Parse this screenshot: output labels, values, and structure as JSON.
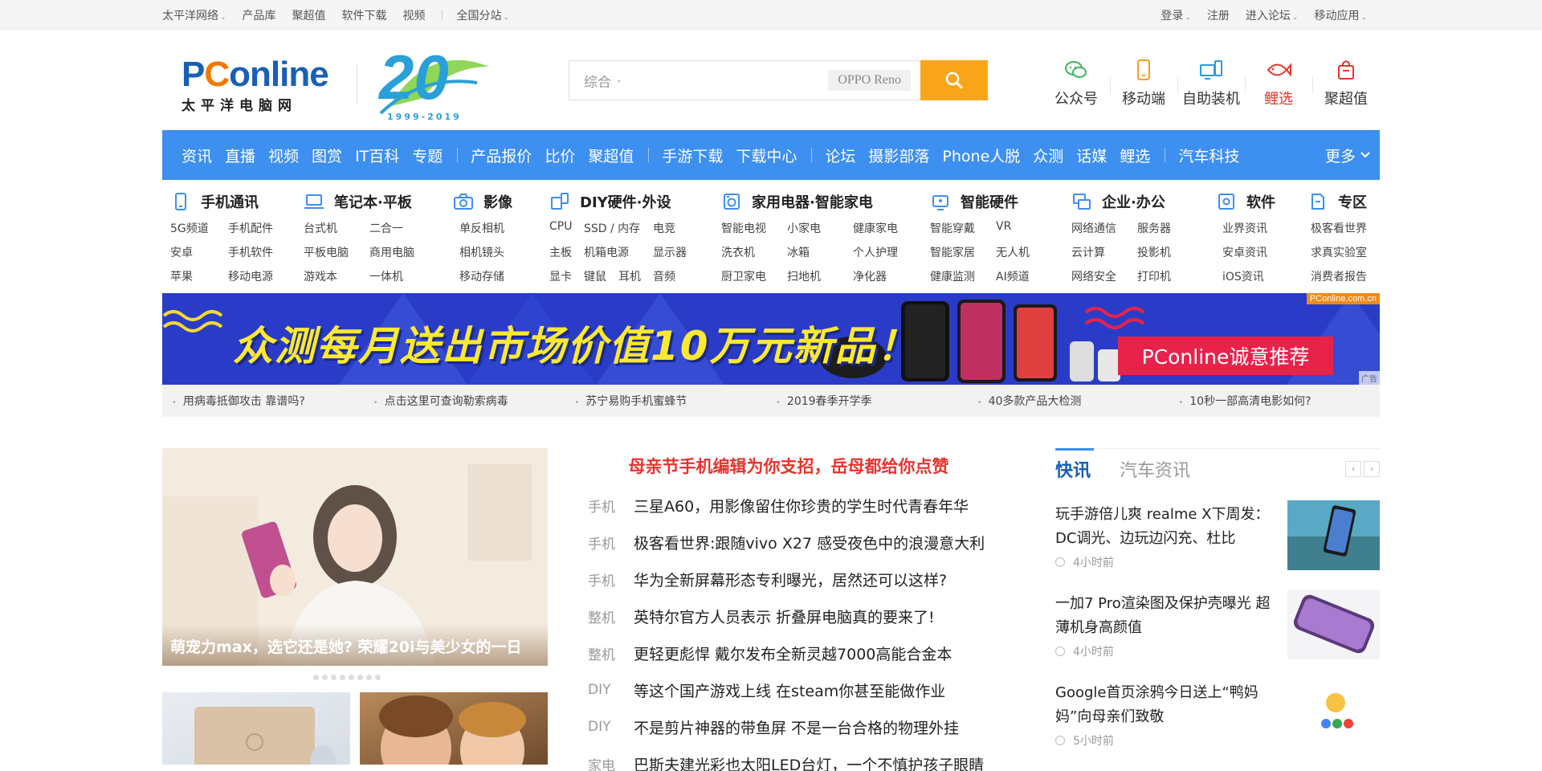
{
  "topbar": {
    "left": [
      "太平洋网络",
      "产品库",
      "聚超值",
      "软件下载",
      "视频"
    ],
    "region": "全国分站",
    "right": [
      "登录",
      "注册",
      "进入论坛",
      "移动应用"
    ]
  },
  "header": {
    "logo_text": "PConline",
    "logo_sub": "太平洋电脑网",
    "anniversary_number": "20",
    "anniversary_years": "1999-2019",
    "search": {
      "category": "综合",
      "hot_word": "OPPO Reno",
      "value": ""
    },
    "quick_links": [
      {
        "label": "公众号",
        "icon": "wechat-icon"
      },
      {
        "label": "移动端",
        "icon": "mobile-icon"
      },
      {
        "label": "自助装机",
        "icon": "pc-build-icon"
      },
      {
        "label": "鲤选",
        "icon": "fish-icon"
      },
      {
        "label": "聚超值",
        "icon": "shopping-bag-icon"
      }
    ],
    "colors": {
      "brand_blue": "#3d8ff0",
      "search_orange": "#f9a51a",
      "accent_red": "#e8332d"
    }
  },
  "nav": {
    "group1": [
      "资讯",
      "直播",
      "视频",
      "图赏",
      "IT百科",
      "专题"
    ],
    "group2": [
      "产品报价",
      "比价",
      "聚超值"
    ],
    "group3": [
      "手游下载",
      "下载中心"
    ],
    "group4": [
      "论坛",
      "摄影部落",
      "Phone人脱",
      "众测",
      "话媒",
      "鲤选"
    ],
    "group5": [
      "汽车科技"
    ],
    "more": "更多"
  },
  "categories": [
    {
      "title": "手机通讯",
      "icon": "phone-icon",
      "rows": [
        [
          "5G频道",
          "手机配件"
        ],
        [
          "安卓",
          "手机软件"
        ],
        [
          "苹果",
          "移动电源"
        ]
      ]
    },
    {
      "title": "笔记本·平板",
      "icon": "laptop-icon",
      "rows": [
        [
          "台式机",
          "二合一"
        ],
        [
          "平板电脑",
          "商用电脑"
        ],
        [
          "游戏本",
          "一体机"
        ]
      ]
    },
    {
      "title": "影像",
      "icon": "camera-icon",
      "rows": [
        [
          "单反相机"
        ],
        [
          "相机镜头"
        ],
        [
          "移动存储"
        ]
      ]
    },
    {
      "title": "DIY硬件·外设",
      "icon": "diy-icon",
      "rows": [
        [
          "CPU",
          "SSD / 内存",
          "电竞"
        ],
        [
          "主板",
          "机箱电源",
          "显示器"
        ],
        [
          "显卡",
          "键鼠",
          "耳机",
          "音频"
        ]
      ]
    },
    {
      "title": "家用电器·智能家电",
      "icon": "appliance-icon",
      "rows": [
        [
          "智能电视",
          "小家电",
          "健康家电"
        ],
        [
          "洗衣机",
          "冰箱",
          "个人护理"
        ],
        [
          "厨卫家电",
          "扫地机",
          "净化器"
        ]
      ]
    },
    {
      "title": "智能硬件",
      "icon": "smart-hardware-icon",
      "rows": [
        [
          "智能穿戴",
          "VR"
        ],
        [
          "智能家居",
          "无人机"
        ],
        [
          "健康监测",
          "AI频道"
        ]
      ]
    },
    {
      "title": "企业·办公",
      "icon": "office-icon",
      "rows": [
        [
          "网络通信",
          "服务器"
        ],
        [
          "云计算",
          "投影机"
        ],
        [
          "网络安全",
          "打印机"
        ]
      ]
    },
    {
      "title": "软件",
      "icon": "software-icon",
      "rows": [
        [
          "业界资讯"
        ],
        [
          "安卓资讯"
        ],
        [
          "iOS资讯"
        ]
      ]
    },
    {
      "title": "专区",
      "icon": "zone-icon",
      "rows": [
        [
          "极客看世界"
        ],
        [
          "求真实验室"
        ],
        [
          "消费者报告"
        ]
      ]
    }
  ],
  "banner": {
    "title": "众测每月送出市场价值10万元新品！",
    "tag": "PConline诚意推荐",
    "site": "PConline.com.cn",
    "ad": "广告"
  },
  "ticker": [
    "用病毒抵御攻击 靠谱吗?",
    "点击这里可查询勒索病毒",
    "苏宁易购手机蜜蜂节",
    "2019春季开学季",
    "40多款产品大检测",
    "10秒一部高清电影如何?"
  ],
  "focus": {
    "caption": "萌宠力max，选它还是她? 荣耀20i与美少女的一日",
    "dot_count": 8
  },
  "news": {
    "headline": "母亲节手机编辑为你支招，岳母都给你点赞",
    "items": [
      {
        "tag": "手机",
        "title": "三星A60，用影像留住你珍贵的学生时代青春年华"
      },
      {
        "tag": "手机",
        "title": "极客看世界:跟随vivo X27 感受夜色中的浪漫意大利"
      },
      {
        "tag": "手机",
        "title": "华为全新屏幕形态专利曝光，居然还可以这样?"
      },
      {
        "tag": "整机",
        "title": "英特尔官方人员表示 折叠屏电脑真的要来了!"
      },
      {
        "tag": "整机",
        "title": "更轻更彪悍 戴尔发布全新灵越7000高能合金本"
      },
      {
        "tag": "DIY",
        "title": "等这个国产游戏上线 在steam你甚至能做作业"
      },
      {
        "tag": "DIY",
        "title": "不是剪片神器的带鱼屏 不是一台合格的物理外挂"
      },
      {
        "tag": "家电",
        "title": "巴斯夫建光彩也太阳LED台灯，一个不慎护孩子眼睛"
      }
    ]
  },
  "side": {
    "tabs": [
      "快讯",
      "汽车资讯"
    ],
    "items": [
      {
        "title": "玩手游倍儿爽 realme X下周发：DC调光、边玩边闪充、杜比",
        "time": "4小时前"
      },
      {
        "title": "一加7 Pro渲染图及保护壳曝光 超薄机身高颜值",
        "time": "4小时前"
      },
      {
        "title": "Google首页涂鸦今日送上“鸭妈妈”向母亲们致敬",
        "time": "5小时前"
      }
    ]
  }
}
